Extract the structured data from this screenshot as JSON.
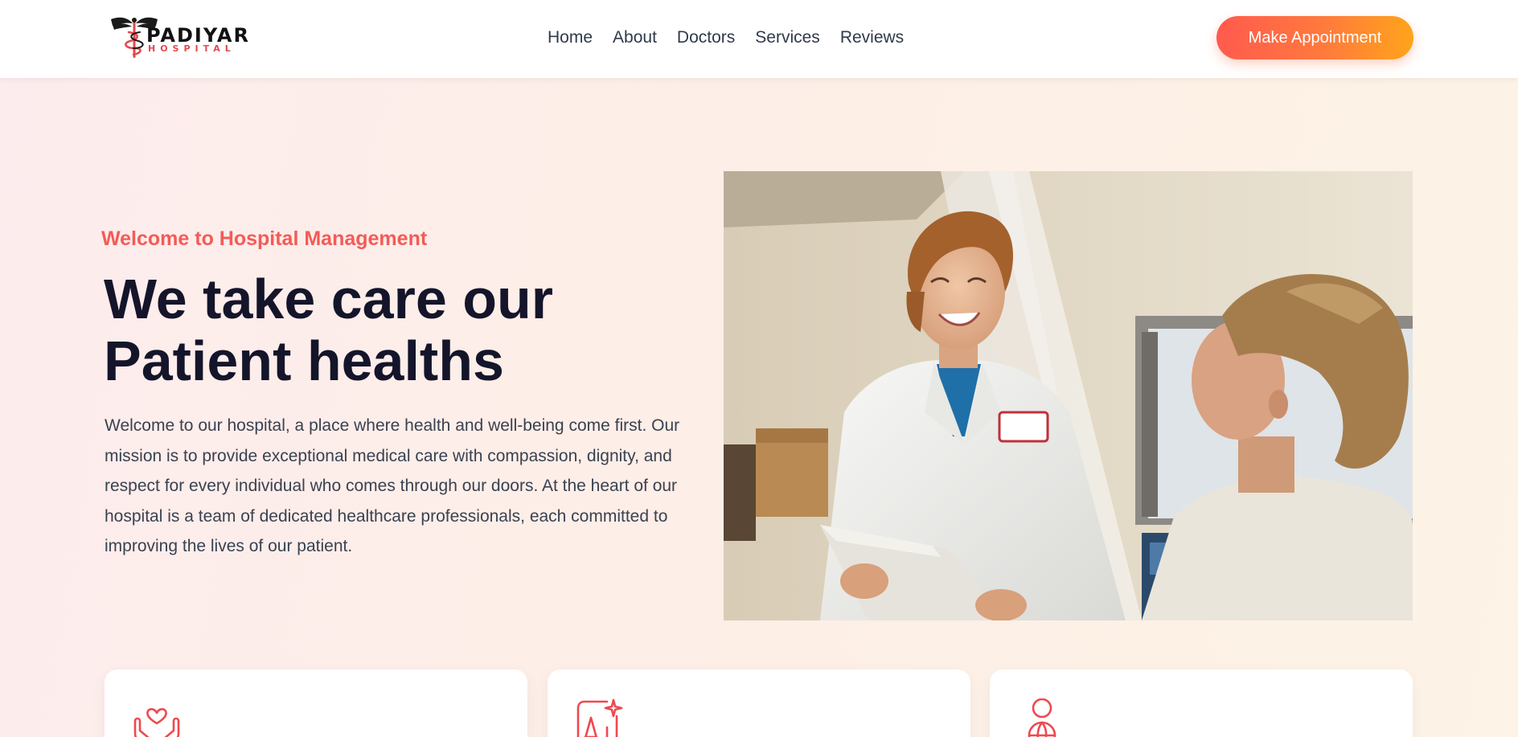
{
  "brand": {
    "name": "PADIYAR",
    "sub": "HOSPITAL",
    "accent_color": "#e5484d"
  },
  "nav": {
    "items": [
      "Home",
      "About",
      "Doctors",
      "Services",
      "Reviews"
    ]
  },
  "cta": {
    "label": "Make Appointment",
    "gradient": [
      "#ff5a4e",
      "#ffa41a"
    ]
  },
  "hero": {
    "eyebrow": "Welcome to Hospital Management",
    "title_line1": "We take care our",
    "title_line2": "Patient healths",
    "description": "Welcome to our hospital, a place where health and well-being come first. Our mission is to provide exceptional medical care with compassion, dignity, and respect for every individual who comes through our doors. At the heart of our hospital is a team of dedicated healthcare professionals, each committed to improving the lives of our patient."
  },
  "features": {
    "cards": [
      {
        "icon": "caring-hands-heart-icon"
      },
      {
        "icon": "ai-sparkle-icon"
      },
      {
        "icon": "person-globe-icon"
      }
    ]
  }
}
